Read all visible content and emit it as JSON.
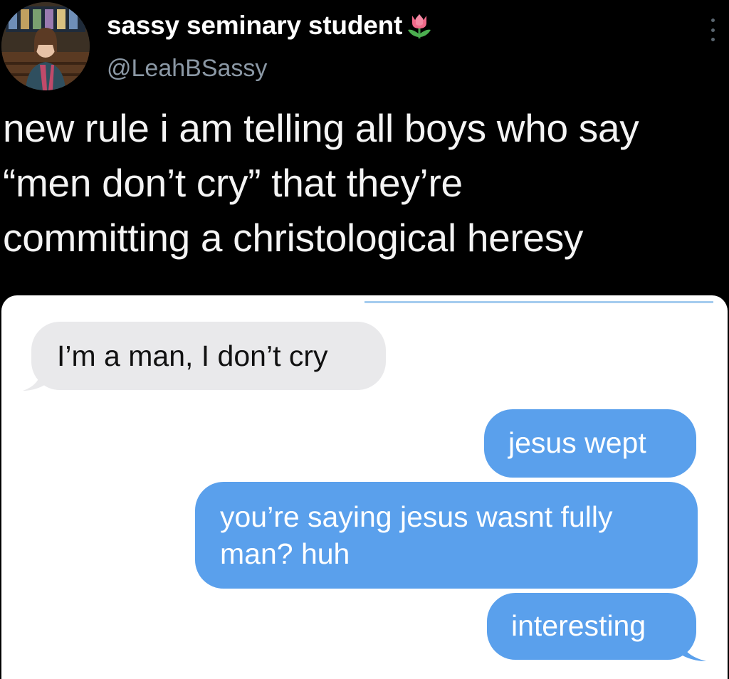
{
  "tweet": {
    "display_name": "sassy seminary student",
    "name_emoji": "tulip-icon",
    "handle": "@LeahBSassy",
    "text_lines": [
      "new rule i am telling all boys who say",
      "“men don’t cry” that they’re",
      "committing a christological heresy"
    ]
  },
  "media": {
    "messages": [
      {
        "side": "received",
        "lines": [
          "I’m a man, I don’t cry"
        ]
      },
      {
        "side": "sent",
        "lines": [
          "jesus wept"
        ]
      },
      {
        "side": "sent",
        "lines": [
          "you’re saying jesus wasnt fully",
          "man? huh"
        ]
      },
      {
        "side": "sent",
        "lines": [
          "interesting"
        ]
      }
    ]
  },
  "colors": {
    "background": "#000000",
    "handle": "#8b98a5",
    "received_bubble": "#e9e9eb",
    "sent_bubble": "#5aa0ec"
  },
  "icons": {
    "more": "more-vertical-icon",
    "avatar": "avatar"
  }
}
